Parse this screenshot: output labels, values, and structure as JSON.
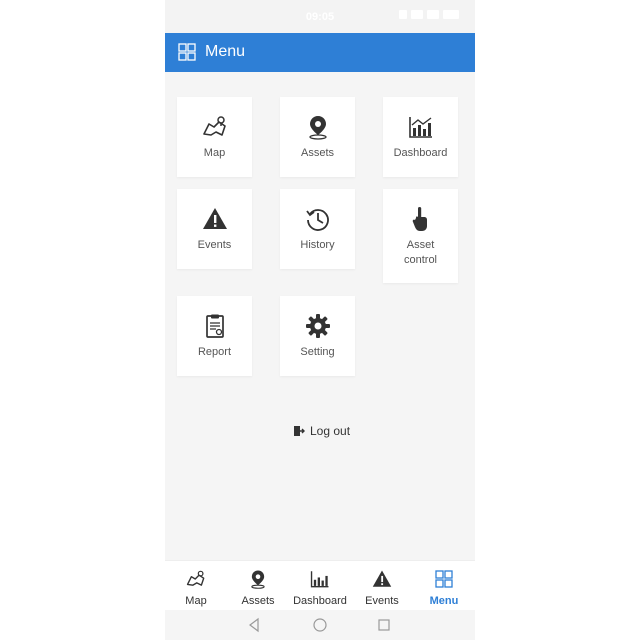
{
  "status": {
    "time": "09:05"
  },
  "appbar": {
    "title": "Menu"
  },
  "menu": {
    "items": [
      {
        "label": "Map",
        "icon": "map-icon"
      },
      {
        "label": "Assets",
        "icon": "location-pin-icon"
      },
      {
        "label": "Dashboard",
        "icon": "dashboard-chart-icon"
      },
      {
        "label": "Events",
        "icon": "warning-icon"
      },
      {
        "label": "History",
        "icon": "history-icon"
      },
      {
        "label": "Asset control",
        "icon": "hand-pointer-icon"
      },
      {
        "label": "Report",
        "icon": "clipboard-icon"
      },
      {
        "label": "Setting",
        "icon": "gear-icon"
      }
    ],
    "logout_label": "Log out"
  },
  "bottom_nav": {
    "items": [
      {
        "label": "Map",
        "icon": "map-icon"
      },
      {
        "label": "Assets",
        "icon": "location-pin-icon"
      },
      {
        "label": "Dashboard",
        "icon": "dashboard-chart-icon"
      },
      {
        "label": "Events",
        "icon": "warning-icon"
      },
      {
        "label": "Menu",
        "icon": "grid-icon",
        "active": true
      }
    ]
  },
  "colors": {
    "primary": "#2e7fd6",
    "background": "#f5f5f5",
    "icon": "#333333"
  }
}
